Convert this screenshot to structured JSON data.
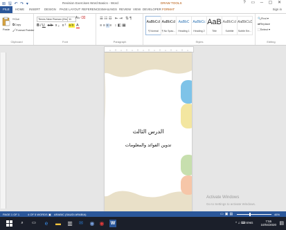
{
  "titlebar": {
    "title": "Revision Exercises Word Basics - Word",
    "context_tab": "DRAW TOOLS",
    "qat": "⊞ 🖫 ↶ ↷ ▾",
    "window_controls": "? ▭ ─ ▢ ✕"
  },
  "tabs": {
    "file": "FILE",
    "items": [
      "HOME",
      "INSERT",
      "DESIGN",
      "PAGE LAYOUT",
      "REFERENCES",
      "MAILINGS",
      "REVIEW",
      "VIEW",
      "DEVELOPER",
      "FORMAT"
    ],
    "signin": "Sign in"
  },
  "ribbon": {
    "clipboard": {
      "paste": "Paste",
      "cut": "Cut",
      "copy": "Copy",
      "format_painter": "Format Painter",
      "label": "Clipboard"
    },
    "font": {
      "font_name": "Times New Roman (Hea",
      "font_size": "11",
      "label": "Font"
    },
    "paragraph": {
      "label": "Paragraph"
    },
    "styles": {
      "label": "Styles",
      "tiles": [
        {
          "preview": "AaBbCcI",
          "name": "¶ Normal"
        },
        {
          "preview": "AaBbCcI",
          "name": "¶ No Spac..."
        },
        {
          "preview": "AaBbC",
          "name": "Heading 1"
        },
        {
          "preview": "AaBbCc",
          "name": "Heading 2"
        },
        {
          "preview": "AaB",
          "name": "Title"
        },
        {
          "preview": "AaBbCcI",
          "name": "Subtitle"
        },
        {
          "preview": "AaBbCcD",
          "name": "Subtle Em..."
        }
      ]
    },
    "editing": {
      "find": "Find ▾",
      "replace": "Replace",
      "select": "Select ▾",
      "label": "Editing"
    }
  },
  "document": {
    "title": "الدرس الثالث",
    "subtitle": "تدوين الفوائد والمعلومات"
  },
  "watermark": {
    "line1": "Activate Windows",
    "line2": "Go to Settings to activate Windows."
  },
  "status": {
    "page": "PAGE 1 OF 1",
    "words": "4 OF 5 WORDS",
    "language": "ARABIC (SAUDI ARABIA)",
    "zoom": "46%"
  },
  "taskbar": {
    "time": "7:55",
    "date": "10/04/2020",
    "tray": "^ ♫ ⌨ ENG"
  },
  "colors": {
    "word_blue": "#2b579a",
    "taskbar": "#1b1f2a",
    "band_blue": "#7ec3e8",
    "band_yellow": "#f3e6a0",
    "band_green": "#c7dfae",
    "band_peach": "#f6c6a8",
    "band_beige": "#e9e0c8"
  }
}
